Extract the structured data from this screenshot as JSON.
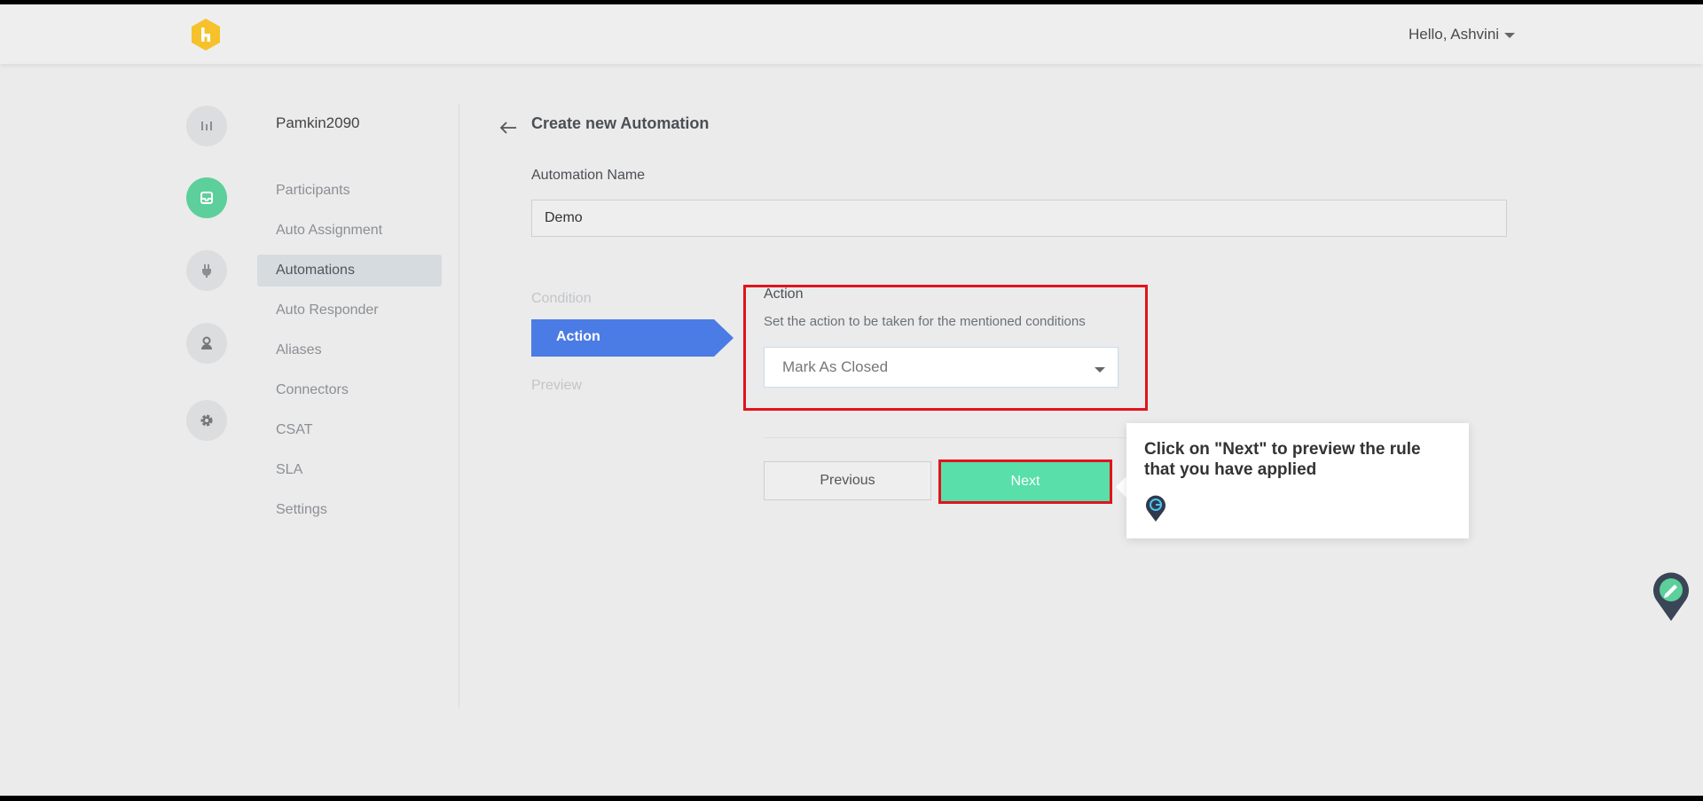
{
  "header": {
    "greeting": "Hello, Ashvini"
  },
  "rail": {
    "icons": [
      "bar-chart-icon",
      "inbox-icon",
      "plug-icon",
      "user-icon",
      "gear-icon"
    ],
    "active_index": 1,
    "active_color": "#5ccf9b"
  },
  "sidebar": {
    "workspace": "Pamkin2090",
    "items": [
      {
        "label": "Participants"
      },
      {
        "label": "Auto Assignment"
      },
      {
        "label": "Automations"
      },
      {
        "label": "Auto Responder"
      },
      {
        "label": "Aliases"
      },
      {
        "label": "Connectors"
      },
      {
        "label": "CSAT"
      },
      {
        "label": "SLA"
      },
      {
        "label": "Settings"
      }
    ],
    "active_item": "Automations"
  },
  "main": {
    "title": "Create new Automation",
    "name_label": "Automation Name",
    "name_value": "Demo",
    "steps": [
      {
        "label": "Condition"
      },
      {
        "label": "Action"
      },
      {
        "label": "Preview"
      }
    ],
    "active_step": "Action",
    "step_active_color": "#4b7be5",
    "action": {
      "title": "Action",
      "description": "Set the action to be taken for the mentioned conditions",
      "selected": "Mark As Closed"
    },
    "buttons": {
      "previous": "Previous",
      "next": "Next"
    },
    "next_color": "#58dfaa",
    "highlight_color": "#e0141c"
  },
  "tooltip": {
    "text": "Click on \"Next\" to preview the rule that you have applied"
  }
}
